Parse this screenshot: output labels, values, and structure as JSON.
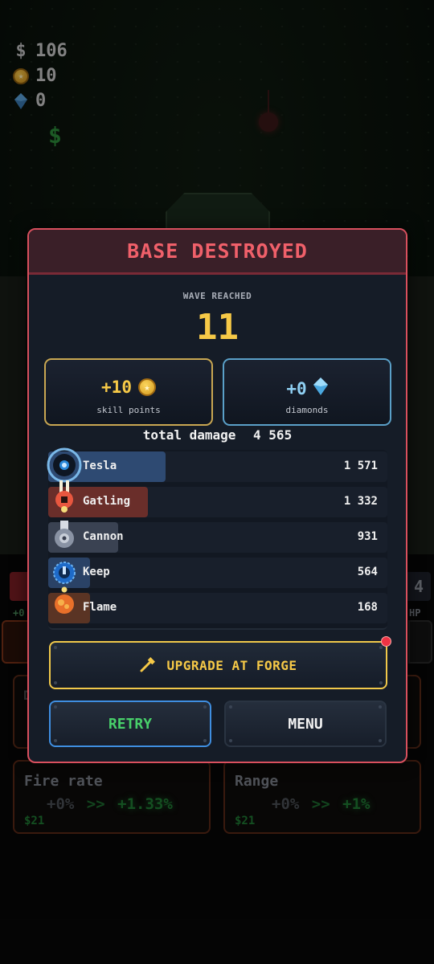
{
  "hud": {
    "money_symbol": "$",
    "money": "106",
    "skill_points": "10",
    "diamonds": "0",
    "cash_drop": "$"
  },
  "background": {
    "peek_left_value": "+0",
    "peek_right_number": "4",
    "peek_right_unit": "HP",
    "upgrade_cards": [
      {
        "title": "Fire rate",
        "current": "+0%",
        "arrow": ">>",
        "next": "+1.33%",
        "price": "$21"
      },
      {
        "title": "Range",
        "current": "+0%",
        "arrow": ">>",
        "next": "+1%",
        "price": "$21"
      }
    ]
  },
  "modal": {
    "title": "BASE DESTROYED",
    "wave_label": "WAVE REACHED",
    "wave_value": "11",
    "rewards": {
      "skill": {
        "value": "+10",
        "label": "skill points",
        "icon": "coin-star-icon"
      },
      "diamonds": {
        "value": "+0",
        "label": "diamonds",
        "icon": "diamond-icon"
      }
    },
    "total_damage_label": "total damage",
    "total_damage_value": "4 565",
    "damage_rows": [
      {
        "name": "Tesla",
        "value": "1 571",
        "damage": 1571,
        "color": "#2e4a72",
        "icon": "tesla-tower-icon"
      },
      {
        "name": "Gatling",
        "value": "1 332",
        "damage": 1332,
        "color": "#6a2e2a",
        "icon": "gatling-tower-icon"
      },
      {
        "name": "Cannon",
        "value": "931",
        "damage": 931,
        "color": "#3a4252",
        "icon": "cannon-tower-icon"
      },
      {
        "name": "Keep",
        "value": "564",
        "damage": 564,
        "color": "#2a4266",
        "icon": "keep-tower-icon"
      },
      {
        "name": "Flame",
        "value": "168",
        "damage": 168,
        "color": "#5a3424",
        "icon": "flame-tower-icon"
      }
    ],
    "forge_button": "UPGRADE AT FORGE",
    "retry_button": "RETRY",
    "menu_button": "MENU",
    "colors": {
      "accent_gold": "#f6c947",
      "accent_red": "#f0606a",
      "retry_green": "#48d06a",
      "diamond_blue": "#8fd0f3"
    }
  }
}
